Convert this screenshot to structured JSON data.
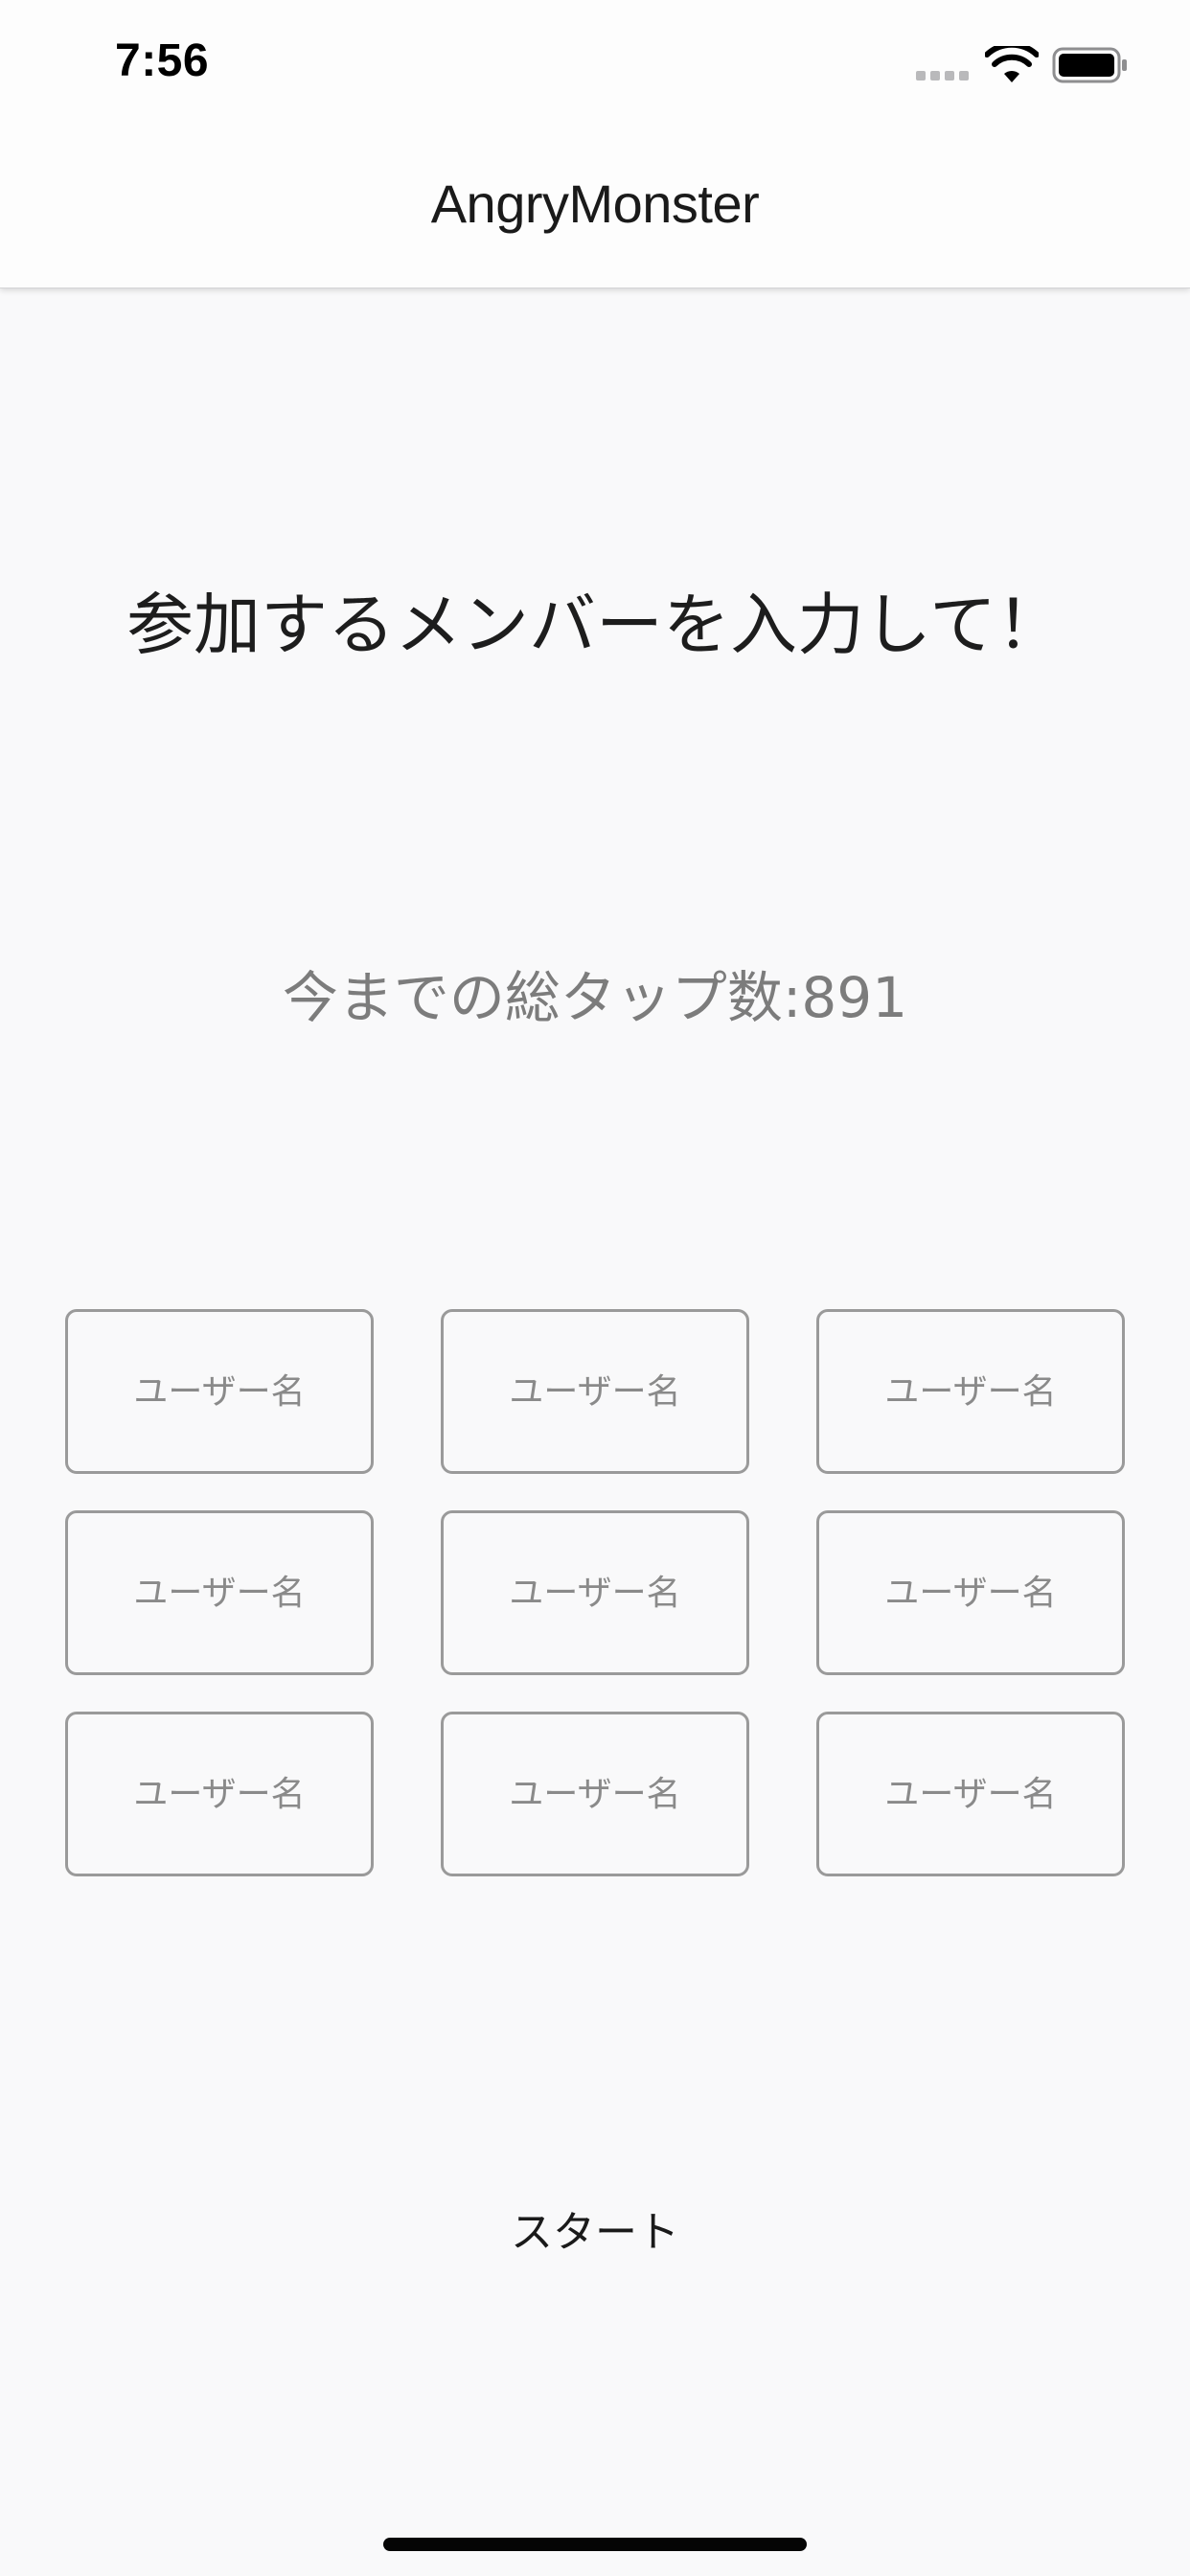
{
  "status_bar": {
    "time": "7:56",
    "icons": [
      "signal-dots-icon",
      "wifi-icon",
      "battery-icon"
    ]
  },
  "nav": {
    "title": "AngryMonster"
  },
  "main": {
    "heading": "参加するメンバーを入力して！",
    "tap_count_label": "今までの総タップ数:",
    "tap_count_value": "891",
    "user_inputs": [
      {
        "placeholder": "ユーザー名",
        "value": ""
      },
      {
        "placeholder": "ユーザー名",
        "value": ""
      },
      {
        "placeholder": "ユーザー名",
        "value": ""
      },
      {
        "placeholder": "ユーザー名",
        "value": ""
      },
      {
        "placeholder": "ユーザー名",
        "value": ""
      },
      {
        "placeholder": "ユーザー名",
        "value": ""
      },
      {
        "placeholder": "ユーザー名",
        "value": ""
      },
      {
        "placeholder": "ユーザー名",
        "value": ""
      },
      {
        "placeholder": "ユーザー名",
        "value": ""
      }
    ],
    "start_label": "スタート"
  },
  "colors": {
    "background": "#f9f9fa",
    "header_background": "#fdfdfd",
    "input_border": "#9a9a9a",
    "placeholder": "#8a8a8a",
    "secondary_text": "#7c7c7c"
  }
}
